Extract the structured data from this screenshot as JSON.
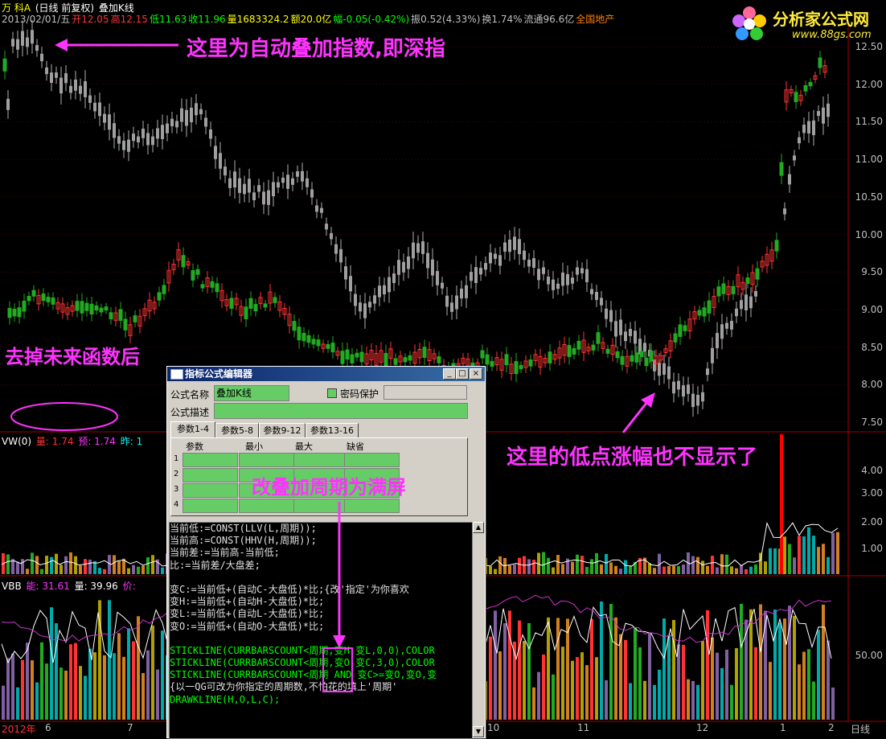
{
  "header": {
    "name": "万 科A",
    "period": "(日线 前复权)",
    "overlay": "叠加K线",
    "date": "2013/02/01/五",
    "open": "开12.05",
    "high": "高12.15",
    "low": "低11.63",
    "close": "收11.96",
    "volume": "量1683324.2",
    "amount": "额20.0亿",
    "change": "幅-0.05(-0.42%)",
    "amplitude": "振0.52(4.33%)",
    "turnover": "换1.74%",
    "float": "流通96.6亿",
    "sector": "全国地产"
  },
  "logo": {
    "text": "分析家公式网",
    "url": "www.88gs.com"
  },
  "annotations": {
    "top": "这里为自动叠加指数,即深指",
    "left": "去掉未来函数后",
    "right": "这里的低点涨幅也不显示了",
    "mid": "改叠加周期为满屏"
  },
  "price_axis": [
    "12.50",
    "12.00",
    "11.50",
    "11.00",
    "10.50",
    "10.00",
    "9.50",
    "9.00",
    "8.50",
    "8.00",
    "7.50"
  ],
  "vol_panel": {
    "name": "VW(0)",
    "line1": "量: 1.74",
    "line2": "预: 1.74",
    "line3": "昨: 1",
    "axis": [
      "4.00",
      "3.00",
      "2.00",
      "1.00"
    ]
  },
  "vbb_panel": {
    "name": "VBB",
    "line1": "能: 31.61",
    "line2": "量: 39.96",
    "line3": "价:",
    "axis": [
      "50.00"
    ]
  },
  "x_axis": [
    "2012年",
    "6",
    "7",
    "10",
    "11",
    "12",
    "1",
    "2",
    "日线"
  ],
  "dialog": {
    "title": "指标公式编辑器",
    "btn_min": "_",
    "btn_max": "□",
    "btn_close": "×",
    "name_label": "公式名称",
    "name_value": "叠加K线",
    "pwd_label": "密码保护",
    "desc_label": "公式描述",
    "tabs": [
      "参数1-4",
      "参数5-8",
      "参数9-12",
      "参数13-16"
    ],
    "cols": [
      "参数",
      "最小",
      "最大",
      "缺省"
    ],
    "rows": [
      "1",
      "2",
      "3",
      "4"
    ],
    "code": [
      "当前低:=CONST(LLV(L,周期));",
      "当前高:=CONST(HHV(H,周期));",
      "当前差:=当前高-当前低;",
      "比:=当前差/大盘差;",
      "",
      "变C:=当前低+(自动C-大盘低)*比;{改'指定'为你喜欢",
      "变H:=当前低+(自动H-大盘低)*比;",
      "变L:=当前低+(自动L-大盘低)*比;",
      "变O:=当前低+(自动O-大盘低)*比;",
      "",
      "STICKLINE(CURRBARSCOUNT<周期,变H,变L,0,0),COLOR",
      "STICKLINE(CURRBARSCOUNT<周期,变O,变C,3,0),COLOR",
      "STICKLINE(CURRBARSCOUNT<周期 AND 变C>=变O,变O,变",
      "{以一QG可改为你指定的周期数,不怕花的填上'周期'",
      "DRAWKLINE(H,O,L,C);"
    ]
  },
  "colors": {
    "up": "#ff3333",
    "down": "#00cccc",
    "grey": "#a0a0a0",
    "green": "#22aa22",
    "magenta": "#ff33ff",
    "grid": "#880000"
  }
}
